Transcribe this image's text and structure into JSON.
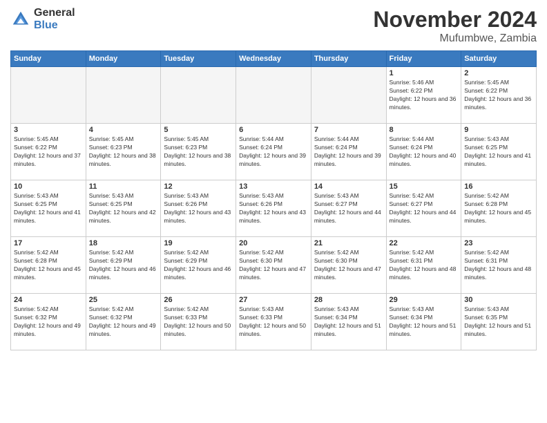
{
  "header": {
    "logo_general": "General",
    "logo_blue": "Blue",
    "month_title": "November 2024",
    "location": "Mufumbwe, Zambia"
  },
  "weekdays": [
    "Sunday",
    "Monday",
    "Tuesday",
    "Wednesday",
    "Thursday",
    "Friday",
    "Saturday"
  ],
  "weeks": [
    [
      {
        "day": "",
        "empty": true
      },
      {
        "day": "",
        "empty": true
      },
      {
        "day": "",
        "empty": true
      },
      {
        "day": "",
        "empty": true
      },
      {
        "day": "",
        "empty": true
      },
      {
        "day": "1",
        "sunrise": "5:46 AM",
        "sunset": "6:22 PM",
        "daylight": "12 hours and 36 minutes."
      },
      {
        "day": "2",
        "sunrise": "5:45 AM",
        "sunset": "6:22 PM",
        "daylight": "12 hours and 36 minutes."
      }
    ],
    [
      {
        "day": "3",
        "sunrise": "5:45 AM",
        "sunset": "6:22 PM",
        "daylight": "12 hours and 37 minutes."
      },
      {
        "day": "4",
        "sunrise": "5:45 AM",
        "sunset": "6:23 PM",
        "daylight": "12 hours and 38 minutes."
      },
      {
        "day": "5",
        "sunrise": "5:45 AM",
        "sunset": "6:23 PM",
        "daylight": "12 hours and 38 minutes."
      },
      {
        "day": "6",
        "sunrise": "5:44 AM",
        "sunset": "6:24 PM",
        "daylight": "12 hours and 39 minutes."
      },
      {
        "day": "7",
        "sunrise": "5:44 AM",
        "sunset": "6:24 PM",
        "daylight": "12 hours and 39 minutes."
      },
      {
        "day": "8",
        "sunrise": "5:44 AM",
        "sunset": "6:24 PM",
        "daylight": "12 hours and 40 minutes."
      },
      {
        "day": "9",
        "sunrise": "5:43 AM",
        "sunset": "6:25 PM",
        "daylight": "12 hours and 41 minutes."
      }
    ],
    [
      {
        "day": "10",
        "sunrise": "5:43 AM",
        "sunset": "6:25 PM",
        "daylight": "12 hours and 41 minutes."
      },
      {
        "day": "11",
        "sunrise": "5:43 AM",
        "sunset": "6:25 PM",
        "daylight": "12 hours and 42 minutes."
      },
      {
        "day": "12",
        "sunrise": "5:43 AM",
        "sunset": "6:26 PM",
        "daylight": "12 hours and 43 minutes."
      },
      {
        "day": "13",
        "sunrise": "5:43 AM",
        "sunset": "6:26 PM",
        "daylight": "12 hours and 43 minutes."
      },
      {
        "day": "14",
        "sunrise": "5:43 AM",
        "sunset": "6:27 PM",
        "daylight": "12 hours and 44 minutes."
      },
      {
        "day": "15",
        "sunrise": "5:42 AM",
        "sunset": "6:27 PM",
        "daylight": "12 hours and 44 minutes."
      },
      {
        "day": "16",
        "sunrise": "5:42 AM",
        "sunset": "6:28 PM",
        "daylight": "12 hours and 45 minutes."
      }
    ],
    [
      {
        "day": "17",
        "sunrise": "5:42 AM",
        "sunset": "6:28 PM",
        "daylight": "12 hours and 45 minutes."
      },
      {
        "day": "18",
        "sunrise": "5:42 AM",
        "sunset": "6:29 PM",
        "daylight": "12 hours and 46 minutes."
      },
      {
        "day": "19",
        "sunrise": "5:42 AM",
        "sunset": "6:29 PM",
        "daylight": "12 hours and 46 minutes."
      },
      {
        "day": "20",
        "sunrise": "5:42 AM",
        "sunset": "6:30 PM",
        "daylight": "12 hours and 47 minutes."
      },
      {
        "day": "21",
        "sunrise": "5:42 AM",
        "sunset": "6:30 PM",
        "daylight": "12 hours and 47 minutes."
      },
      {
        "day": "22",
        "sunrise": "5:42 AM",
        "sunset": "6:31 PM",
        "daylight": "12 hours and 48 minutes."
      },
      {
        "day": "23",
        "sunrise": "5:42 AM",
        "sunset": "6:31 PM",
        "daylight": "12 hours and 48 minutes."
      }
    ],
    [
      {
        "day": "24",
        "sunrise": "5:42 AM",
        "sunset": "6:32 PM",
        "daylight": "12 hours and 49 minutes."
      },
      {
        "day": "25",
        "sunrise": "5:42 AM",
        "sunset": "6:32 PM",
        "daylight": "12 hours and 49 minutes."
      },
      {
        "day": "26",
        "sunrise": "5:42 AM",
        "sunset": "6:33 PM",
        "daylight": "12 hours and 50 minutes."
      },
      {
        "day": "27",
        "sunrise": "5:43 AM",
        "sunset": "6:33 PM",
        "daylight": "12 hours and 50 minutes."
      },
      {
        "day": "28",
        "sunrise": "5:43 AM",
        "sunset": "6:34 PM",
        "daylight": "12 hours and 51 minutes."
      },
      {
        "day": "29",
        "sunrise": "5:43 AM",
        "sunset": "6:34 PM",
        "daylight": "12 hours and 51 minutes."
      },
      {
        "day": "30",
        "sunrise": "5:43 AM",
        "sunset": "6:35 PM",
        "daylight": "12 hours and 51 minutes."
      }
    ]
  ]
}
